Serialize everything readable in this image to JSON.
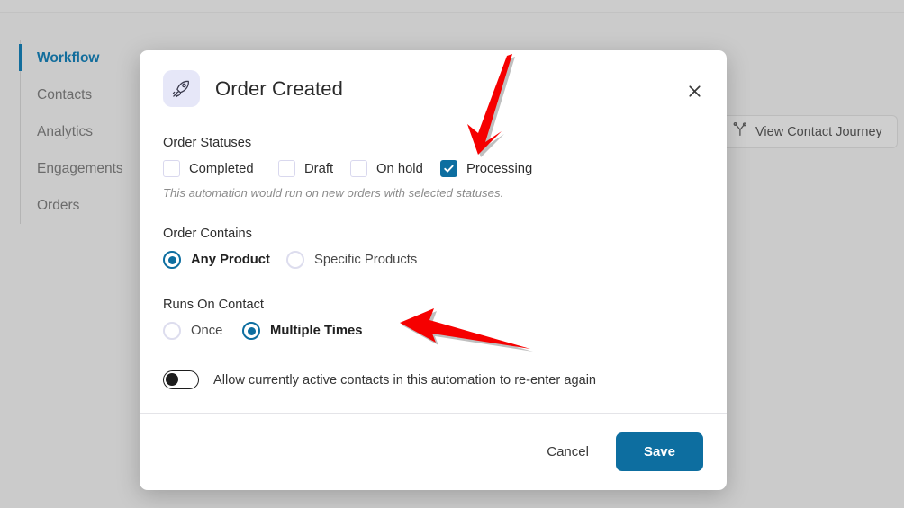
{
  "sidebar": {
    "items": [
      {
        "label": "Workflow",
        "active": true
      },
      {
        "label": "Contacts",
        "active": false
      },
      {
        "label": "Analytics",
        "active": false
      },
      {
        "label": "Engagements",
        "active": false
      },
      {
        "label": "Orders",
        "active": false
      }
    ]
  },
  "toolbar": {
    "view_contact_journey": "View Contact Journey",
    "journey_icon": "branch-journey-icon"
  },
  "modal": {
    "icon": "rocket-icon",
    "title": "Order Created",
    "close_icon": "close-icon",
    "order_statuses": {
      "label": "Order Statuses",
      "options": [
        {
          "label": "Completed",
          "checked": false
        },
        {
          "label": "Draft",
          "checked": false
        },
        {
          "label": "On hold",
          "checked": false
        },
        {
          "label": "Processing",
          "checked": true
        }
      ],
      "help_text": "This automation would run on new orders with selected statuses."
    },
    "order_contains": {
      "label": "Order Contains",
      "options": [
        {
          "label": "Any Product",
          "selected": true
        },
        {
          "label": "Specific Products",
          "selected": false
        }
      ]
    },
    "runs_on_contact": {
      "label": "Runs On Contact",
      "options": [
        {
          "label": "Once",
          "selected": false
        },
        {
          "label": "Multiple Times",
          "selected": true
        }
      ]
    },
    "reenter_toggle": {
      "label": "Allow currently active contacts in this automation to re-enter again",
      "on": false
    },
    "footer": {
      "cancel_label": "Cancel",
      "save_label": "Save"
    }
  },
  "colors": {
    "accent_blue": "#0d6ea0",
    "sidebar_active": "#126d9c",
    "page_background": "#cbcbcb",
    "modal_background": "#ffffff",
    "annotation_red": "#f60000",
    "rocket_badge_bg": "#e6e7f8"
  },
  "annotations": [
    {
      "name": "arrow-to-processing-checkbox",
      "direction": "down-left",
      "target": "Processing"
    },
    {
      "name": "arrow-to-multiple-times-radio",
      "direction": "left",
      "target": "Multiple Times"
    }
  ]
}
